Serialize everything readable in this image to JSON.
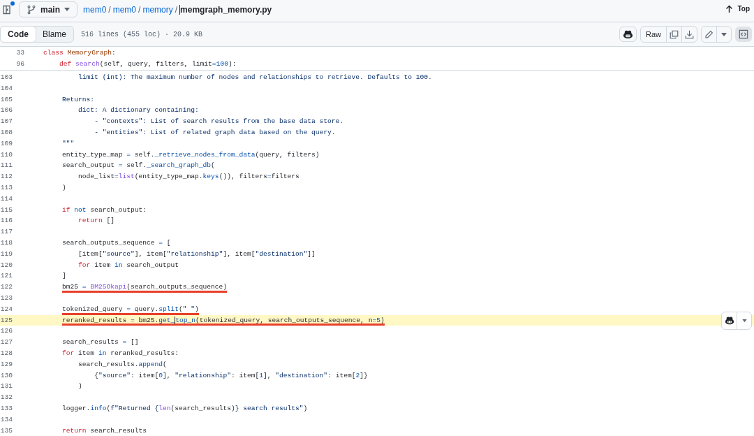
{
  "header": {
    "sidebar_toggle": {
      "unread": true
    },
    "branch": "main",
    "breadcrumb": [
      {
        "label": "mem0",
        "link": true
      },
      {
        "separator": "/",
        "label": "mem0",
        "link": true
      },
      {
        "separator": "/",
        "label": "memory",
        "link": true
      },
      {
        "separator": "/",
        "label": "memgraph_memory.py",
        "link": false
      }
    ],
    "top_link": "Top"
  },
  "toolbar": {
    "view_tabs": [
      {
        "label": "Code",
        "selected": true
      },
      {
        "label": "Blame",
        "selected": false
      }
    ],
    "file_info": "516 lines (455 loc) · 20.9 KB",
    "raw_button": "Raw",
    "symbols_toggle": {
      "selected": true
    }
  },
  "sticky_lines": [
    {
      "number": "33",
      "tokens": [
        {
          "text": "    class",
          "kind": "keyword"
        },
        {
          "text": " MemoryGraph",
          "kind": "classname"
        },
        {
          "text": ":",
          "kind": "plain"
        }
      ]
    },
    {
      "number": "96",
      "tokens": [
        {
          "text": "        def",
          "kind": "keyword"
        },
        {
          "text": " search",
          "kind": "builtin"
        },
        {
          "text": "(self, query, filters, limit",
          "kind": "plain"
        },
        {
          "text": "=",
          "kind": "operator"
        },
        {
          "text": "100",
          "kind": "number"
        },
        {
          "text": "):",
          "kind": "plain"
        }
      ]
    }
  ],
  "lines": [
    {
      "number": "103",
      "highlighted": false,
      "underlined": false,
      "tokens": [
        {
          "text": "            limit (int): The maximum number of nodes and relationships to retrieve. Defaults to 100.",
          "kind": "docstring"
        }
      ]
    },
    {
      "number": "104",
      "highlighted": false
    },
    {
      "number": "105",
      "highlighted": false,
      "underlined": false,
      "tokens": [
        {
          "text": "        Returns:",
          "kind": "docstring"
        }
      ]
    },
    {
      "number": "106",
      "highlighted": false,
      "underlined": false,
      "tokens": [
        {
          "text": "            dict: A dictionary containing:",
          "kind": "docstring"
        }
      ]
    },
    {
      "number": "107",
      "highlighted": false,
      "underlined": false,
      "tokens": [
        {
          "text": "                - \"contexts\": List of search results from the base data store.",
          "kind": "docstring"
        }
      ]
    },
    {
      "number": "108",
      "highlighted": false,
      "underlined": false,
      "tokens": [
        {
          "text": "                - \"entities\": List of related graph data based on the query.",
          "kind": "docstring"
        }
      ]
    },
    {
      "number": "109",
      "highlighted": false,
      "underlined": false,
      "tokens": [
        {
          "text": "        \"\"\"",
          "kind": "docstring"
        }
      ]
    },
    {
      "number": "110",
      "highlighted": false,
      "underlined": false,
      "tokens": [
        {
          "text": "        entity_type_map ",
          "kind": "plain"
        },
        {
          "text": "=",
          "kind": "operator"
        },
        {
          "text": " self.",
          "kind": "plain"
        },
        {
          "text": "_retrieve_nodes_from_data",
          "kind": "method"
        },
        {
          "text": "(query, filters)",
          "kind": "plain"
        }
      ]
    },
    {
      "number": "111",
      "highlighted": false,
      "underlined": false,
      "tokens": [
        {
          "text": "        search_output ",
          "kind": "plain"
        },
        {
          "text": "=",
          "kind": "operator"
        },
        {
          "text": " self.",
          "kind": "plain"
        },
        {
          "text": "_search_graph_db",
          "kind": "method"
        },
        {
          "text": "(",
          "kind": "plain"
        }
      ]
    },
    {
      "number": "112",
      "highlighted": false,
      "underlined": false,
      "tokens": [
        {
          "text": "            node_list",
          "kind": "plain"
        },
        {
          "text": "=",
          "kind": "operator"
        },
        {
          "text": "list",
          "kind": "builtin"
        },
        {
          "text": "(entity_type_map.",
          "kind": "plain"
        },
        {
          "text": "keys",
          "kind": "method"
        },
        {
          "text": "()), filters",
          "kind": "plain"
        },
        {
          "text": "=",
          "kind": "operator"
        },
        {
          "text": "filters",
          "kind": "plain"
        }
      ]
    },
    {
      "number": "113",
      "highlighted": false,
      "underlined": false,
      "tokens": [
        {
          "text": "        )",
          "kind": "plain"
        }
      ]
    },
    {
      "number": "114",
      "highlighted": false
    },
    {
      "number": "115",
      "highlighted": false,
      "underlined": false,
      "tokens": [
        {
          "text": "        if",
          "kind": "keyword"
        },
        {
          "text": " not",
          "kind": "operator"
        },
        {
          "text": " search_output:",
          "kind": "plain"
        }
      ]
    },
    {
      "number": "116",
      "highlighted": false,
      "underlined": false,
      "tokens": [
        {
          "text": "            return",
          "kind": "keyword"
        },
        {
          "text": " []",
          "kind": "plain"
        }
      ]
    },
    {
      "number": "117",
      "highlighted": false
    },
    {
      "number": "118",
      "highlighted": false,
      "underlined": false,
      "tokens": [
        {
          "text": "        search_outputs_sequence ",
          "kind": "plain"
        },
        {
          "text": "=",
          "kind": "operator"
        },
        {
          "text": " [",
          "kind": "plain"
        }
      ]
    },
    {
      "number": "119",
      "highlighted": false,
      "underlined": false,
      "tokens": [
        {
          "text": "            [item[",
          "kind": "plain"
        },
        {
          "text": "\"source\"",
          "kind": "string"
        },
        {
          "text": "], item[",
          "kind": "plain"
        },
        {
          "text": "\"relationship\"",
          "kind": "string"
        },
        {
          "text": "], item[",
          "kind": "plain"
        },
        {
          "text": "\"destination\"",
          "kind": "string"
        },
        {
          "text": "]]",
          "kind": "plain"
        }
      ]
    },
    {
      "number": "120",
      "highlighted": false,
      "underlined": false,
      "tokens": [
        {
          "text": "            for",
          "kind": "keyword"
        },
        {
          "text": " item ",
          "kind": "plain"
        },
        {
          "text": "in",
          "kind": "operator"
        },
        {
          "text": " search_output",
          "kind": "plain"
        }
      ]
    },
    {
      "number": "121",
      "highlighted": false,
      "underlined": false,
      "tokens": [
        {
          "text": "        ]",
          "kind": "plain"
        }
      ]
    },
    {
      "number": "122",
      "highlighted": false,
      "underlined": true,
      "tokens": [
        {
          "text": "        bm25 ",
          "kind": "plain"
        },
        {
          "text": "=",
          "kind": "operator"
        },
        {
          "text": " BM25Okapi",
          "kind": "builtin"
        },
        {
          "text": "(search_outputs_sequence)",
          "kind": "plain"
        }
      ]
    },
    {
      "number": "123",
      "highlighted": false
    },
    {
      "number": "124",
      "highlighted": false,
      "underlined": true,
      "tokens": [
        {
          "text": "        tokenized_query ",
          "kind": "plain"
        },
        {
          "text": "=",
          "kind": "operator"
        },
        {
          "text": " query.",
          "kind": "plain"
        },
        {
          "text": "split",
          "kind": "method"
        },
        {
          "text": "(",
          "kind": "plain"
        },
        {
          "text": "\" \"",
          "kind": "string"
        },
        {
          "text": ")",
          "kind": "plain"
        }
      ]
    },
    {
      "number": "125",
      "highlighted": true,
      "underlined": true,
      "tokens": [
        {
          "text": "        reranked_results ",
          "kind": "plain"
        },
        {
          "text": "=",
          "kind": "operator"
        },
        {
          "text": " bm25.",
          "kind": "plain"
        },
        {
          "text": "get_",
          "kind": "method"
        },
        {
          "text": "top_n",
          "kind": "method",
          "cursor": true
        },
        {
          "text": "(tokenized_query, search_outputs_sequence, n",
          "kind": "plain"
        },
        {
          "text": "=",
          "kind": "operator"
        },
        {
          "text": "5",
          "kind": "number"
        },
        {
          "text": ")",
          "kind": "plain"
        }
      ]
    },
    {
      "number": "126",
      "highlighted": false
    },
    {
      "number": "127",
      "highlighted": false,
      "underlined": false,
      "tokens": [
        {
          "text": "        search_results ",
          "kind": "plain"
        },
        {
          "text": "=",
          "kind": "operator"
        },
        {
          "text": " []",
          "kind": "plain"
        }
      ]
    },
    {
      "number": "128",
      "highlighted": false,
      "underlined": false,
      "tokens": [
        {
          "text": "        for",
          "kind": "keyword"
        },
        {
          "text": " item ",
          "kind": "plain"
        },
        {
          "text": "in",
          "kind": "operator"
        },
        {
          "text": " reranked_results:",
          "kind": "plain"
        }
      ]
    },
    {
      "number": "129",
      "highlighted": false,
      "underlined": false,
      "tokens": [
        {
          "text": "            search_results.",
          "kind": "plain"
        },
        {
          "text": "append",
          "kind": "method"
        },
        {
          "text": "(",
          "kind": "plain"
        }
      ]
    },
    {
      "number": "130",
      "highlighted": false,
      "underlined": false,
      "tokens": [
        {
          "text": "                {",
          "kind": "plain"
        },
        {
          "text": "\"source\"",
          "kind": "string"
        },
        {
          "text": ": item[",
          "kind": "plain"
        },
        {
          "text": "0",
          "kind": "number"
        },
        {
          "text": "], ",
          "kind": "plain"
        },
        {
          "text": "\"relationship\"",
          "kind": "string"
        },
        {
          "text": ": item[",
          "kind": "plain"
        },
        {
          "text": "1",
          "kind": "number"
        },
        {
          "text": "], ",
          "kind": "plain"
        },
        {
          "text": "\"destination\"",
          "kind": "string"
        },
        {
          "text": ": item[",
          "kind": "plain"
        },
        {
          "text": "2",
          "kind": "number"
        },
        {
          "text": "]}",
          "kind": "plain"
        }
      ]
    },
    {
      "number": "131",
      "highlighted": false,
      "underlined": false,
      "tokens": [
        {
          "text": "            )",
          "kind": "plain"
        }
      ]
    },
    {
      "number": "132",
      "highlighted": false
    },
    {
      "number": "133",
      "highlighted": false,
      "underlined": false,
      "tokens": [
        {
          "text": "        logger.",
          "kind": "plain"
        },
        {
          "text": "info",
          "kind": "method"
        },
        {
          "text": "(",
          "kind": "plain"
        },
        {
          "text": "f\"Returned {",
          "kind": "string"
        },
        {
          "text": "len",
          "kind": "builtin"
        },
        {
          "text": "(search_results)",
          "kind": "plain"
        },
        {
          "text": "} search results\"",
          "kind": "string"
        },
        {
          "text": ")",
          "kind": "plain"
        }
      ]
    },
    {
      "number": "134",
      "highlighted": false
    },
    {
      "number": "135",
      "highlighted": false,
      "underlined": false,
      "tokens": [
        {
          "text": "        return",
          "kind": "keyword"
        },
        {
          "text": " search_results",
          "kind": "plain"
        }
      ]
    }
  ]
}
